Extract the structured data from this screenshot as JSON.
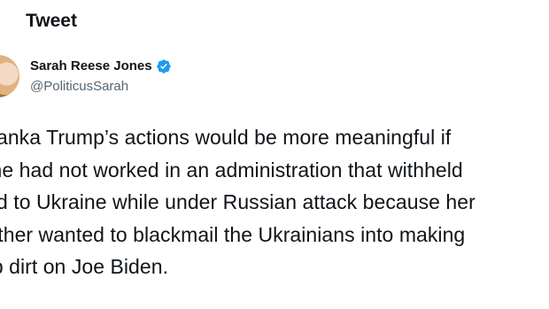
{
  "header": {
    "title": "Tweet"
  },
  "author": {
    "display_name": "Sarah Reese Jones",
    "handle": "@PoliticusSarah",
    "verified_icon": "verified-badge-icon",
    "verified_color": "#1d9bf0"
  },
  "tweet": {
    "text": "Ivanka Trump’s actions would be more meaningful if\nshe had not worked in an administration that withheld\naid to Ukraine while under Russian attack because her\nfather wanted to blackmail the Ukrainians into making\nup dirt on Joe Biden."
  }
}
